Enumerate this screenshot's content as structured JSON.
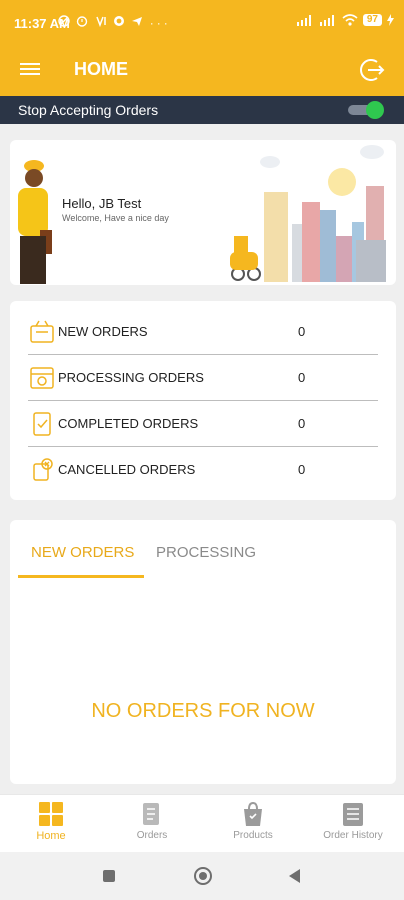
{
  "status_bar": {
    "time": "11:37 AM",
    "icons": [
      "cancel-wifi-icon",
      "alarm-icon",
      "volte-icon",
      "whatsapp-icon",
      "telegram-icon",
      "more-icon"
    ],
    "more": "···",
    "battery": "97"
  },
  "app_bar": {
    "title": "HOME"
  },
  "accept_orders": {
    "label": "Stop Accepting Orders",
    "enabled": true
  },
  "greeting": {
    "hello": "Hello, JB Test",
    "subtitle": "Welcome, Have a nice day"
  },
  "stats": [
    {
      "label": "NEW ORDERS",
      "count": "0",
      "icon": "new-orders-icon"
    },
    {
      "label": "PROCESSING ORDERS",
      "count": "0",
      "icon": "processing-orders-icon"
    },
    {
      "label": "COMPLETED ORDERS",
      "count": "0",
      "icon": "completed-orders-icon"
    },
    {
      "label": "CANCELLED ORDERS",
      "count": "0",
      "icon": "cancelled-orders-icon"
    }
  ],
  "orders_tabs": {
    "tabs": [
      "NEW ORDERS",
      "PROCESSING"
    ],
    "active": 0
  },
  "empty_message": "NO ORDERS FOR NOW",
  "bottom_nav": [
    {
      "label": "Home",
      "icon": "home-grid-icon",
      "active": true
    },
    {
      "label": "Orders",
      "icon": "orders-icon",
      "active": false
    },
    {
      "label": "Products",
      "icon": "products-bag-icon",
      "active": false
    },
    {
      "label": "Order History",
      "icon": "order-history-icon",
      "active": false
    }
  ],
  "colors": {
    "primary": "#f5b71f",
    "accent_text": "#e8a91a",
    "toolbar_dark": "#2b3546",
    "toggle_on": "#2fc84f",
    "background": "#efefef"
  }
}
